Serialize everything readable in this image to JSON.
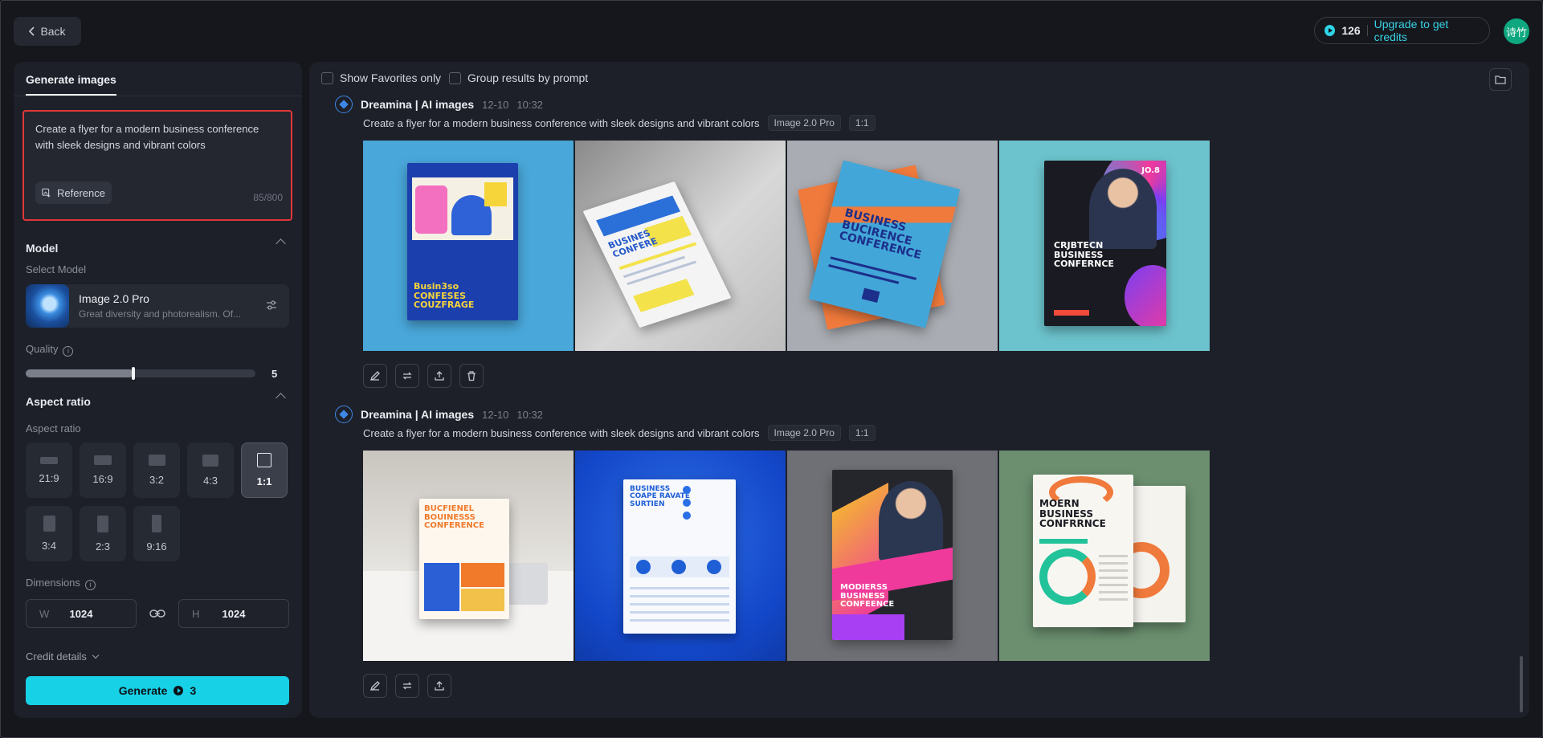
{
  "header": {
    "back_label": "Back",
    "credits_count": "126",
    "upgrade_label": "Upgrade to get credits",
    "avatar_text": "诗竹"
  },
  "left_panel": {
    "tab_label": "Generate images",
    "prompt_text": "Create a flyer for a modern business conference with sleek designs and vibrant colors",
    "reference_label": "Reference",
    "char_count": "85/800",
    "model_section": "Model",
    "select_model_label": "Select Model",
    "model_name": "Image 2.0 Pro",
    "model_desc": "Great diversity and photorealism. Of...",
    "quality_label": "Quality",
    "quality_value": "5",
    "quality_fraction": 0.47,
    "aspect_section": "Aspect ratio",
    "aspect_sub": "Aspect ratio",
    "ratios": [
      {
        "label": "21:9"
      },
      {
        "label": "16:9"
      },
      {
        "label": "3:2"
      },
      {
        "label": "4:3"
      },
      {
        "label": "1:1"
      },
      {
        "label": "3:4"
      },
      {
        "label": "2:3"
      },
      {
        "label": "9:16"
      }
    ],
    "selected_ratio": "1:1",
    "dimensions_label": "Dimensions",
    "width_label": "W",
    "width_value": "1024",
    "height_label": "H",
    "height_value": "1024",
    "credit_details_label": "Credit details",
    "generate_label": "Generate",
    "generate_cost": "3"
  },
  "results": {
    "show_favorites_label": "Show Favorites only",
    "group_by_prompt_label": "Group results by prompt",
    "groups": [
      {
        "source": "Dreamina | AI images",
        "date": "12-10",
        "time": "10:32",
        "prompt": "Create a flyer for a modern business conference with sleek designs and vibrant colors",
        "model_tag": "Image 2.0 Pro",
        "ratio_tag": "1:1",
        "images": [
          {
            "flyer_text": "Busin3so\nCONFESES\nCOUZFRAGE"
          },
          {
            "flyer_text": "BUSINES\nCONFERE"
          },
          {
            "flyer_text": "BUSINESS\nBUCIRENCE\nCONFERENCE"
          },
          {
            "flyer_text": "CRJBTECN\nBUSINESS\nCONFERNCE",
            "corner_text": "JO.8"
          }
        ]
      },
      {
        "source": "Dreamina | AI images",
        "date": "12-10",
        "time": "10:32",
        "prompt": "Create a flyer for a modern business conference with sleek designs and vibrant colors",
        "model_tag": "Image 2.0 Pro",
        "ratio_tag": "1:1",
        "images": [
          {
            "flyer_text": "BUCFIENEL\nBOUINESSS\nCONFERENCE"
          },
          {
            "flyer_text": "BUSINESS\nCOAPE RAVATE\nSURTIEN"
          },
          {
            "flyer_text": "MODIERSS\nBUSINESS\nCONFEENCE"
          },
          {
            "flyer_text": "MOERN\nBUSINESS\nCONFRRNCE"
          }
        ]
      }
    ]
  },
  "colors": {
    "accent": "#17d1e6",
    "upgrade_text": "#38d3e4",
    "highlight_border": "#e0373a",
    "avatar_bg": "#0fa77f"
  }
}
